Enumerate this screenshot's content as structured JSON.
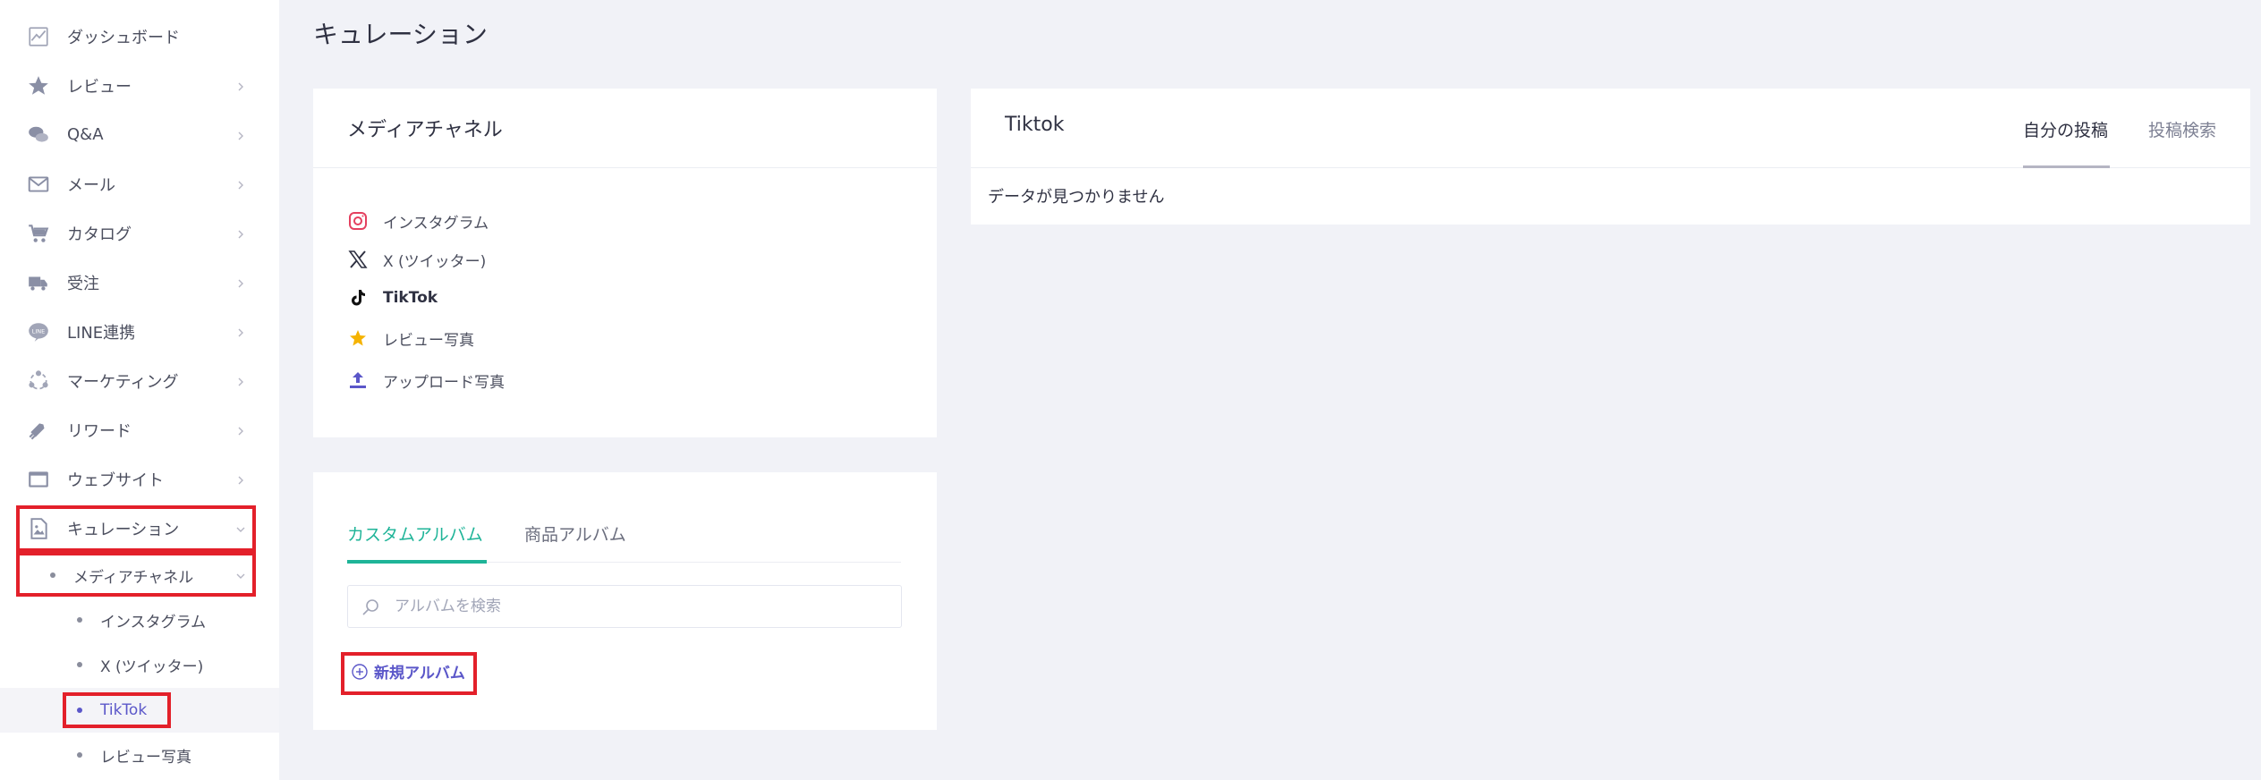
{
  "sidebar": {
    "items": [
      {
        "label": "ダッシュボード",
        "icon": "chart-icon"
      },
      {
        "label": "レビュー",
        "icon": "star-icon"
      },
      {
        "label": "Q&A",
        "icon": "chat-bubbles-icon"
      },
      {
        "label": "メール",
        "icon": "envelope-icon"
      },
      {
        "label": "カタログ",
        "icon": "cart-icon"
      },
      {
        "label": "受注",
        "icon": "truck-icon"
      },
      {
        "label": "LINE連携",
        "icon": "line-icon"
      },
      {
        "label": "マーケティング",
        "icon": "marketing-icon"
      },
      {
        "label": "リワード",
        "icon": "reward-icon"
      },
      {
        "label": "ウェブサイト",
        "icon": "browser-window-icon"
      },
      {
        "label": "キュレーション",
        "icon": "image-document-icon"
      }
    ],
    "sub_items": [
      {
        "label": "メディアチャネル"
      },
      {
        "label": "インスタグラム"
      },
      {
        "label": "X (ツイッター)"
      },
      {
        "label": "TikTok"
      },
      {
        "label": "レビュー写真"
      }
    ]
  },
  "page": {
    "title": "キュレーション"
  },
  "media_card": {
    "title": "メディアチャネル",
    "channels": [
      {
        "label": "インスタグラム",
        "icon": "instagram-icon"
      },
      {
        "label": "X (ツイッター)",
        "icon": "x-logo-icon"
      },
      {
        "label": "TikTok",
        "icon": "tiktok-icon"
      },
      {
        "label": "レビュー写真",
        "icon": "star-icon"
      },
      {
        "label": "アップロード写真",
        "icon": "upload-icon"
      }
    ]
  },
  "album_card": {
    "tabs": [
      {
        "label": "カスタムアルバム"
      },
      {
        "label": "商品アルバム"
      }
    ],
    "search_placeholder": "アルバムを検索",
    "new_album_label": "新規アルバム"
  },
  "tiktok_card": {
    "title": "Tiktok",
    "tabs": [
      {
        "label": "自分の投稿"
      },
      {
        "label": "投稿検索"
      }
    ],
    "empty_message": "データが見つかりません"
  },
  "colors": {
    "accent_purple": "#5b57c9",
    "accent_green": "#1fb498",
    "highlight_red": "#e3202a",
    "instagram_pink": "#e4405f",
    "star_yellow": "#f5b301"
  }
}
